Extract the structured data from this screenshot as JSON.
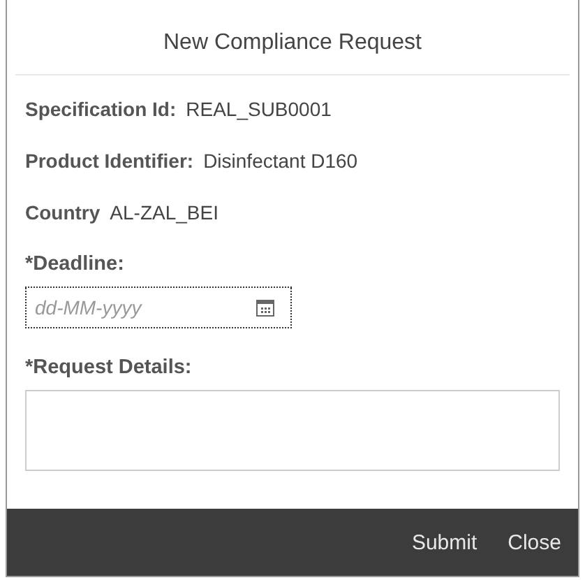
{
  "dialog": {
    "title": "New Compliance Request"
  },
  "info_rows": [
    {
      "label": "Specification Id:",
      "value": "REAL_SUB0001"
    },
    {
      "label": "Product Identifier:",
      "value": "Disinfectant D160"
    },
    {
      "label": "Country",
      "value": "AL-ZAL_BEI"
    }
  ],
  "deadline": {
    "label": "*Deadline:",
    "placeholder": "dd-MM-yyyy"
  },
  "request_details": {
    "label": "*Request Details:"
  },
  "buttons": [
    "Submit",
    "Close"
  ]
}
